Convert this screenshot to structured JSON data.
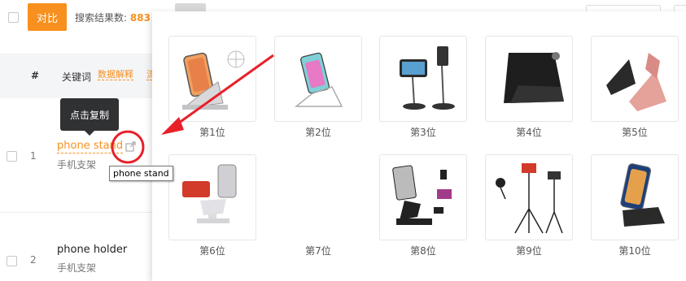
{
  "toolbar": {
    "compare_label": "对比",
    "search_count_label": "搜索结果数:",
    "search_count_value": "883"
  },
  "table_header": {
    "index_col": "#",
    "keyword_col": "关键词",
    "data_explain_link": "数据解释",
    "next_link_partial": "流"
  },
  "rows": [
    {
      "index": "1",
      "keyword": "phone stand",
      "keyword_cn": "手机支架"
    },
    {
      "index": "2",
      "keyword": "phone holder",
      "keyword_cn": "手机支架"
    }
  ],
  "tooltip": {
    "text": "点击复制"
  },
  "native_tooltip": {
    "text": "phone stand"
  },
  "popup": {
    "products": [
      {
        "rank_label": "第1位"
      },
      {
        "rank_label": "第2位"
      },
      {
        "rank_label": "第3位"
      },
      {
        "rank_label": "第4位"
      },
      {
        "rank_label": "第5位"
      },
      {
        "rank_label": "第6位"
      },
      {
        "rank_label": "第7位"
      },
      {
        "rank_label": "第8位"
      },
      {
        "rank_label": "第9位"
      },
      {
        "rank_label": "第10位"
      }
    ]
  },
  "colors": {
    "accent": "#f7901e",
    "annotation_red": "#e8202a",
    "tooltip_bg": "#303133"
  },
  "icons": [
    "copy-link-icon"
  ]
}
